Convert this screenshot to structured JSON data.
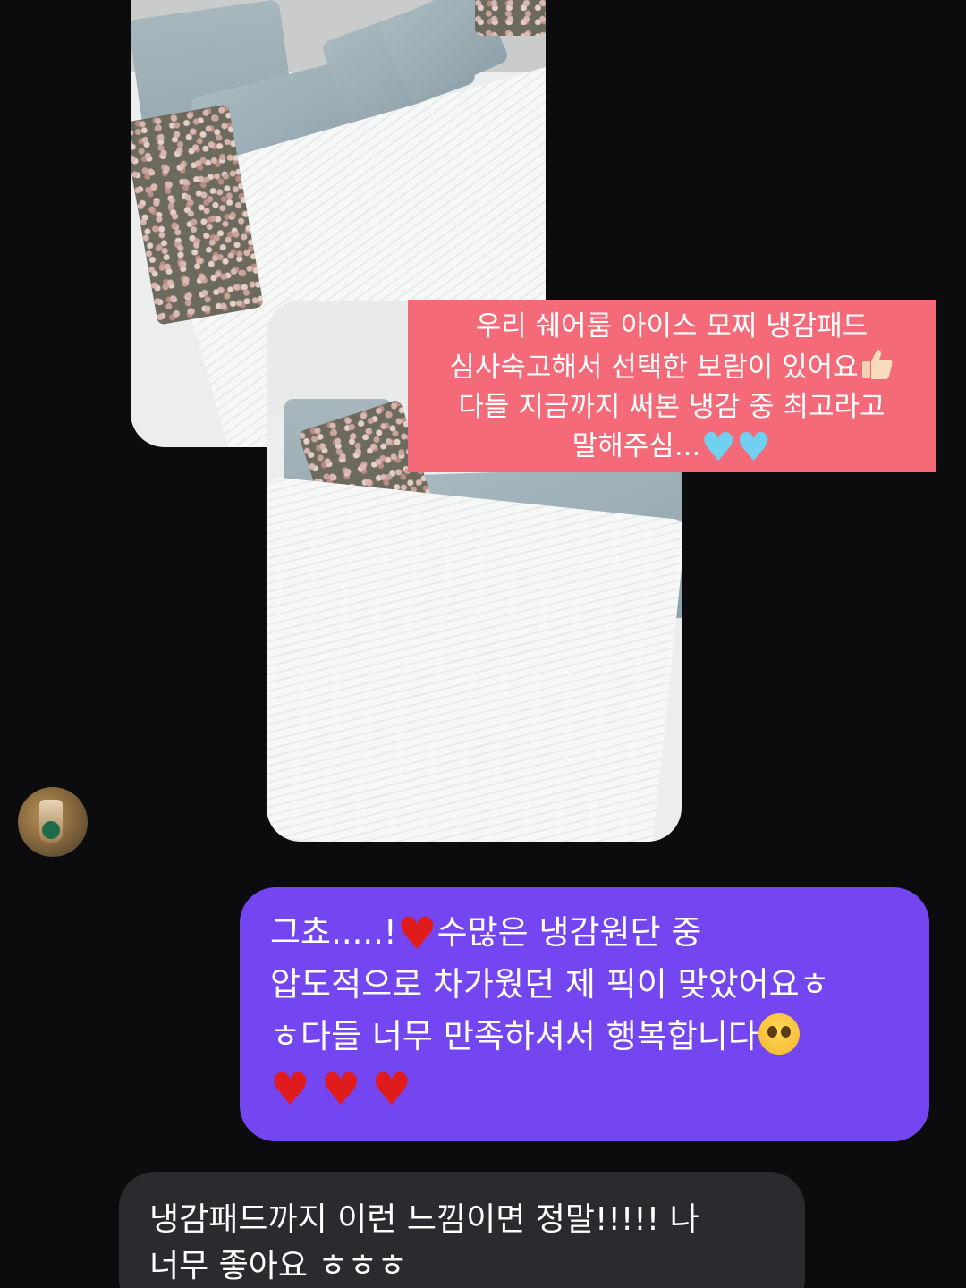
{
  "story": {
    "caption_lines": [
      "우리 쉐어룸 아이스 모찌 냉감패드",
      "심사숙고해서 선택한 보람이 있어요",
      "다들 지금까지 써본 냉감 중 최고라고",
      "말해주심..."
    ],
    "caption_emoji": [
      "thumbs-up-icon",
      "blue-heart-icon",
      "blue-heart-icon"
    ],
    "caption_color": "#f46a78"
  },
  "messages": {
    "outgoing": {
      "line1_a": "그쵸.....!",
      "line1_b": "수많은 냉감원단 중",
      "line2": "압도적으로 차가웠던 제 픽이 맞았어요ㅎ",
      "line3": "ㅎ다들 너무 만족하셔서 행복합니다",
      "bubble_color": "#7446f2"
    },
    "incoming": {
      "line1": "냉감패드까지 이런 느낌이면 정말!!!!! 나",
      "line2": "너무 좋아요 ㅎㅎㅎ",
      "bubble_color": "#2a2b2f"
    }
  }
}
